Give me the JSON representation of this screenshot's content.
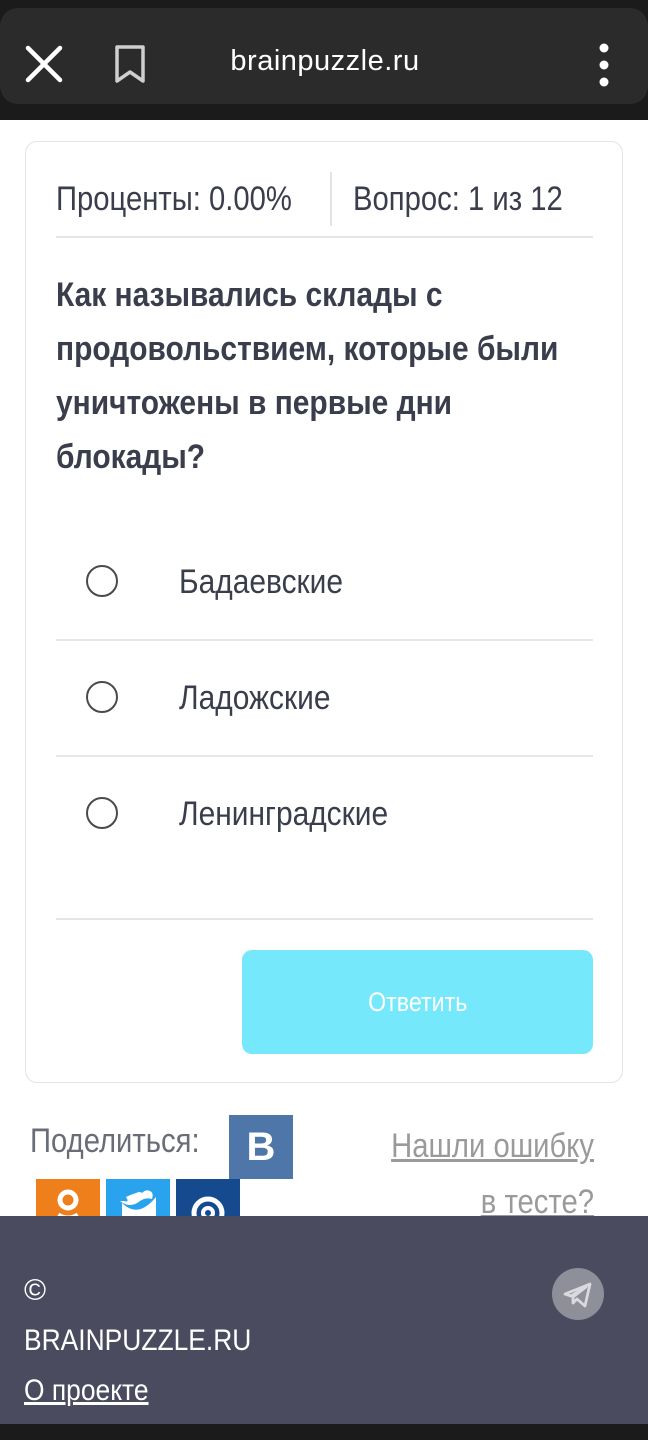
{
  "browser": {
    "url": "brainpuzzle.ru",
    "close_icon": "close-icon",
    "bookmark_icon": "bookmark-icon",
    "menu_icon": "more-vertical-icon"
  },
  "quiz": {
    "percent_label": "Проценты: 0.00%",
    "question_counter": "Вопрос: 1 из 12",
    "question": "Как назывались склады с продовольствием, которые были уничтожены в первые дни блокады?",
    "answers": [
      {
        "label": "Бадаевские",
        "selected": false
      },
      {
        "label": "Ладожские",
        "selected": false
      },
      {
        "label": "Ленинградские",
        "selected": false
      }
    ],
    "submit_label": "Ответить"
  },
  "share": {
    "label": "Поделиться:",
    "vk_letter": "В",
    "networks": [
      "vk-icon",
      "odnoklassniki-icon",
      "twitter-icon",
      "mail-icon"
    ]
  },
  "report_link": "Нашли ошибку в тесте?",
  "footer": {
    "copyright": "©",
    "site_name": "BRAINPUZZLE.RU",
    "about": "О проекте",
    "telegram_icon": "telegram-icon"
  },
  "colors": {
    "accent_button": "#75e9fb",
    "text": "#3a3d4b",
    "footer_bg": "#4a4b5e",
    "vk": "#4f76a8",
    "ok": "#ef7f1a",
    "twitter": "#2aa3ef",
    "mail": "#154a8e"
  }
}
